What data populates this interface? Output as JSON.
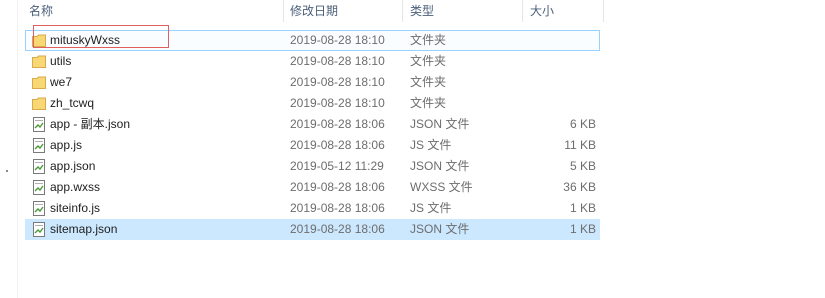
{
  "columns": {
    "name": "名称",
    "modified": "修改日期",
    "type": "类型",
    "size": "大小"
  },
  "files": [
    {
      "name": "mituskyWxss",
      "modified": "2019-08-28 18:10",
      "type": "文件夹",
      "size": "",
      "icon": "folder-icon"
    },
    {
      "name": "utils",
      "modified": "2019-08-28 18:10",
      "type": "文件夹",
      "size": "",
      "icon": "folder-icon"
    },
    {
      "name": "we7",
      "modified": "2019-08-28 18:10",
      "type": "文件夹",
      "size": "",
      "icon": "folder-icon"
    },
    {
      "name": "zh_tcwq",
      "modified": "2019-08-28 18:10",
      "type": "文件夹",
      "size": "",
      "icon": "folder-icon"
    },
    {
      "name": "app - 副本.json",
      "modified": "2019-08-28 18:06",
      "type": "JSON 文件",
      "size": "6 KB",
      "icon": "file-icon"
    },
    {
      "name": "app.js",
      "modified": "2019-08-28 18:06",
      "type": "JS 文件",
      "size": "11 KB",
      "icon": "file-icon"
    },
    {
      "name": "app.json",
      "modified": "2019-05-12 11:29",
      "type": "JSON 文件",
      "size": "5 KB",
      "icon": "file-icon"
    },
    {
      "name": "app.wxss",
      "modified": "2019-08-28 18:06",
      "type": "WXSS 文件",
      "size": "36 KB",
      "icon": "file-icon"
    },
    {
      "name": "siteinfo.js",
      "modified": "2019-08-28 18:06",
      "type": "JS 文件",
      "size": "1 KB",
      "icon": "file-icon"
    },
    {
      "name": "sitemap.json",
      "modified": "2019-08-28 18:06",
      "type": "JSON 文件",
      "size": "1 KB",
      "icon": "file-icon"
    }
  ],
  "colors": {
    "folder": "#f8d775",
    "selection": "#cce8ff",
    "annotation": "#e06060"
  }
}
